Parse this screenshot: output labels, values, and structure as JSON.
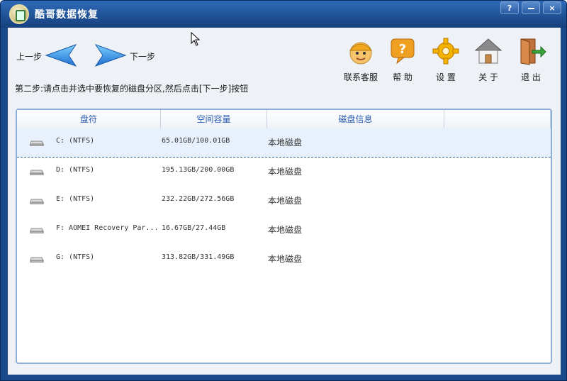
{
  "window": {
    "title": "酷哥数据恢复",
    "buttons": {
      "help": "?",
      "minimize": "-",
      "close": "×"
    }
  },
  "nav": {
    "prev_label": "上一步",
    "next_label": "下一步"
  },
  "toolbar": [
    {
      "icon": "customer-service-icon",
      "label": "联系客服"
    },
    {
      "icon": "help-icon",
      "label": "帮 助"
    },
    {
      "icon": "settings-gear-icon",
      "label": "设 置"
    },
    {
      "icon": "home-icon",
      "label": "关 于"
    },
    {
      "icon": "exit-door-icon",
      "label": "退 出"
    }
  ],
  "instruction": "第二步:请点击并选中要恢复的磁盘分区,然后点击[下一步]按钮",
  "table": {
    "columns": [
      "盘符",
      "空间容量",
      "磁盘信息"
    ],
    "rows": [
      {
        "name": "C:  (NTFS)",
        "capacity": "65.01GB/100.01GB",
        "info": "本地磁盘",
        "selected": true
      },
      {
        "name": "D:  (NTFS)",
        "capacity": "195.13GB/200.00GB",
        "info": "本地磁盘"
      },
      {
        "name": "E:  (NTFS)",
        "capacity": "232.22GB/272.56GB",
        "info": "本地磁盘"
      },
      {
        "name": "F:  AOMEI Recovery Par...",
        "capacity": "16.67GB/27.44GB",
        "info": "本地磁盘"
      },
      {
        "name": "G:  (NTFS)",
        "capacity": "313.82GB/331.49GB",
        "info": "本地磁盘"
      }
    ]
  },
  "colors": {
    "frame": "#1a4a8c",
    "title_text": "#ffffff",
    "header_text": "#2a5ab2",
    "selected_row": "#e8f1fb",
    "arrow": "#3aa2e8"
  }
}
